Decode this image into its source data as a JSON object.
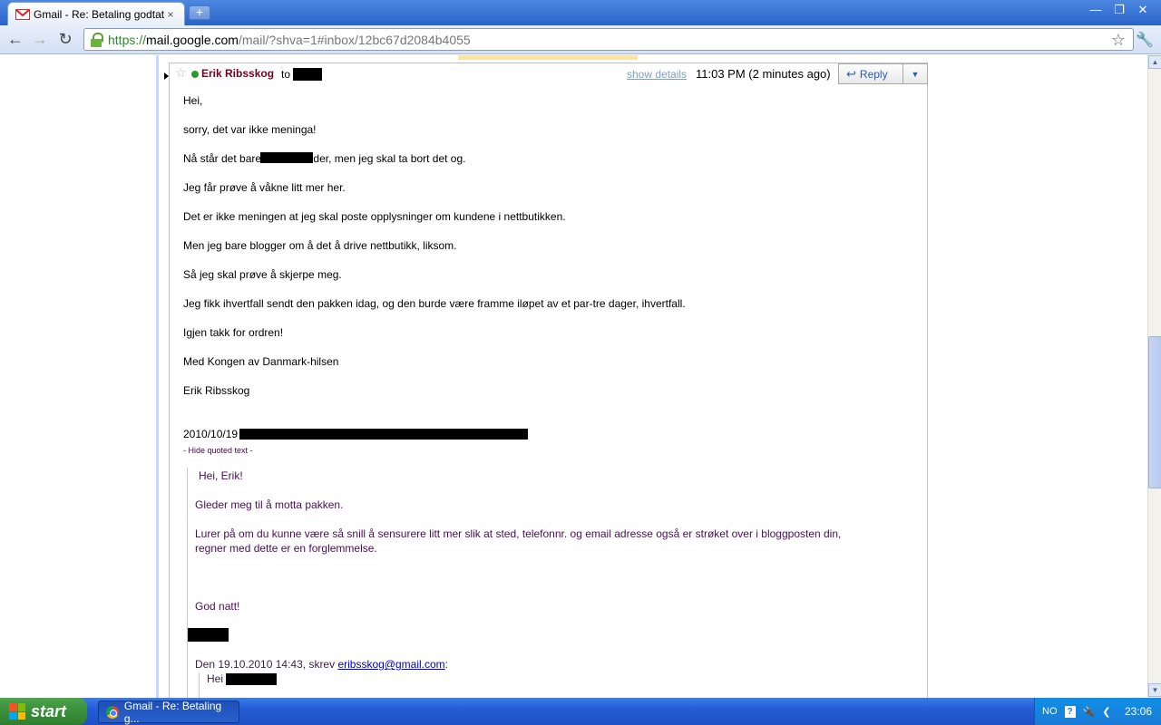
{
  "browser": {
    "tab_title": "Gmail - Re: Betaling godtat...",
    "tab_close": "×",
    "new_tab": "+",
    "url_scheme": "https://",
    "url_host": "mail.google.com",
    "url_path": "/mail/?shva=1#inbox/12bc67d2084b4055",
    "window_buttons": {
      "minimize": "—",
      "restore": "❐",
      "close": "✕"
    }
  },
  "message": {
    "sender": "Erik Ribsskog",
    "to_label": "to",
    "show_details": "show details",
    "time": "11:03 PM (2 minutes ago)",
    "reply_label": "Reply",
    "reply_dropdown": "▼",
    "body": [
      "Hei,",
      "sorry, det var ikke meninga!",
      "Nå står det bare ",
      "der, men jeg skal ta bort det og.",
      "Jeg får prøve å våkne litt mer her.",
      "Det er ikke meningen at jeg skal poste opplysninger om kundene i nettbutikken.",
      "Men jeg bare blogger om å det å drive nettbutikk, liksom.",
      "Så jeg skal prøve å skjerpe meg.",
      "Jeg fikk ihvertfall sendt den pakken idag, og den burde være framme iløpet av et par-tre dager, ihvertfall.",
      "Igjen takk for ordren!",
      "Med Kongen av Danmark-hilsen",
      "Erik Ribsskog"
    ],
    "quote_date": "2010/10/19",
    "hide_quoted": "- Hide quoted text -",
    "quoted": {
      "greeting": "Hei, Erik!",
      "line1": "Gleder meg til å motta pakken.",
      "line2a": "Lurer på om du kunne være så snill å sensurere litt mer slik at sted, telefonnr. og email adresse også er strøket over i bloggposten din,",
      "line2b": "regner med dette er en forglemmelse.",
      "signoff": "God natt!",
      "reply_header_prefix": "Den 19.10.2010 14:43, skrev ",
      "reply_email": "eribsskog@gmail.com",
      "reply_header_suffix": ":",
      "nested_greeting": "Hei"
    }
  },
  "taskbar": {
    "start_label": "start",
    "task_title": "Gmail - Re: Betaling g...",
    "lang": "NO",
    "help": "?",
    "clock": "23:06"
  }
}
